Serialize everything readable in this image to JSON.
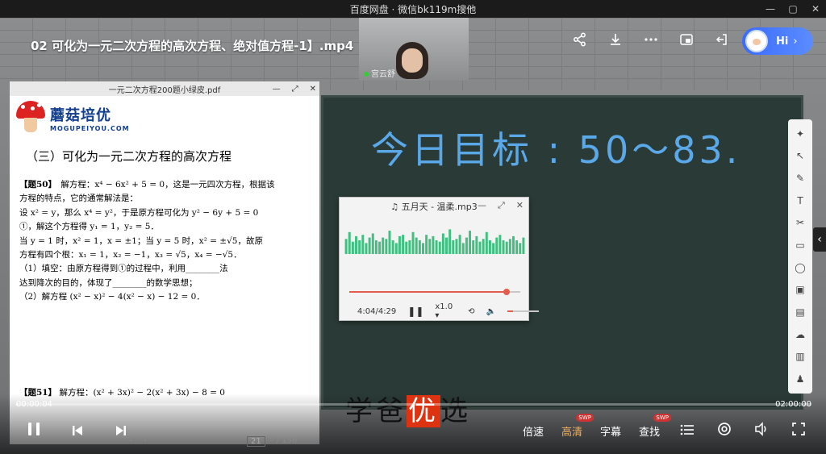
{
  "window": {
    "title": "百度网盘 · 微信bk119m搜他",
    "controls": [
      "—",
      "▢",
      "✕"
    ]
  },
  "video": {
    "title": "02 可化为一元二次方程的高次方程、绝对值方程-1】.mp4",
    "top_icons": [
      "share-icon",
      "download-icon",
      "more-icon",
      "pip-icon",
      "exit-icon"
    ],
    "hi_label": "Hi",
    "current_time": "00:00:04",
    "total_time": "02:00:00",
    "progress": 0.0006
  },
  "webcam": {
    "name": "宫云舒"
  },
  "board": {
    "goal_text": "今日目标 : 50～83."
  },
  "tools": [
    "pointer-icon",
    "move-icon",
    "pen-icon",
    "text-icon",
    "scissors-icon",
    "trash-icon",
    "shape-icon",
    "image-icon",
    "chat-icon",
    "cloud-icon",
    "toolbox-icon",
    "users-icon"
  ],
  "pdf": {
    "title": "一元二次方程200题小绿皮.pdf",
    "controls": [
      "—",
      "⤢",
      "✕"
    ],
    "logo_cn": "蘑菇培优",
    "logo_en": "MOGUPEIYOU.COM",
    "section": "（三）可化为一元二次方程的高次方程",
    "q50_label": "【题50】",
    "q50_lines": [
      "解方程：x⁴ − 6x² + 5 = 0，这是一元四次方程，根据该",
      "方程的特点，它的通常解法是：",
      "设 x² = y，那么 x⁴ = y²，于是原方程可化为 y² − 6y + 5 = 0",
      "①，解这个方程得 y₁ = 1，y₂ = 5．",
      "当 y = 1 时，x² = 1，x = ±1；当 y = 5 时，x² = ±√5，故原",
      "方程有四个根：x₁ = 1，x₂ = −1，x₃ = √5，x₄ = −√5．",
      "（1）填空：由原方程得到①的过程中，利用________法",
      "达到降次的目的，体现了________的数学思想；",
      "（2）解方程 (x² − x)² − 4(x² − x) − 12 = 0．"
    ],
    "q51_label": "【题51】",
    "q51_text": "解方程：(x² + 3x)² − 2(x² + 3x) − 8 = 0",
    "page_current": "21",
    "page_total": "/ 156"
  },
  "music": {
    "title": "五月天 - 温柔.mp3",
    "controls": [
      "—",
      "⤢",
      "✕"
    ],
    "time": "4:04/4:29",
    "speed": "x1.0",
    "progress": 0.92,
    "volume": 0.18,
    "eq_levels": [
      0.55,
      0.8,
      0.45,
      0.65,
      0.5,
      0.7,
      0.4,
      0.6,
      0.75,
      0.5,
      0.45,
      0.6,
      0.55,
      0.85,
      0.5,
      0.4,
      0.65,
      0.7,
      0.45,
      0.5,
      0.8,
      0.6,
      0.5,
      0.4,
      0.7,
      0.55,
      0.65,
      0.5,
      0.45,
      0.75,
      0.6,
      0.9,
      0.5,
      0.55,
      0.7,
      0.4,
      0.6,
      0.85,
      0.5,
      0.65,
      0.45,
      0.55,
      0.8,
      0.5,
      0.4,
      0.6,
      0.7,
      0.5,
      0.45,
      0.55,
      0.65,
      0.5,
      0.4,
      0.6
    ],
    "accent": "#e65b4b",
    "eq_color": "#3fbf80"
  },
  "watermark": {
    "pre": "学爸",
    "highlight": "优",
    "post": "选"
  },
  "controls": {
    "speed": "倍速",
    "quality": "高清",
    "subtitle": "字幕",
    "search": "查找",
    "badge": "SWP"
  }
}
